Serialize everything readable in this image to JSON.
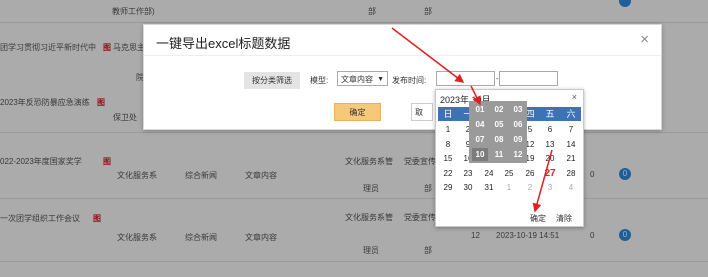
{
  "background_table": {
    "rows": [
      {
        "title": "",
        "dept_frag": "教师工作部)",
        "col3": "部",
        "col4": "部"
      },
      {
        "title": "团学习贯彻习近平新时代中",
        "doc_tag": "图",
        "person": "马克思主"
      },
      {
        "person2": "院"
      },
      {
        "title": "2023年反恐防暴应急演练",
        "doc_tag": "图",
        "dept": "保卫处"
      },
      {
        "title": "022-2023年度国家奖学",
        "doc_tag": "图",
        "dept": "文化服务系",
        "category": "综合新闻",
        "type": "文章内容",
        "dept_mgmt": "文化服务系管",
        "publisher": "党委宣传",
        "org_frag": "理员",
        "org_frag2": "部",
        "views": "0",
        "badge": "0"
      },
      {
        "title": "一次团学组织工作会议",
        "doc_tag": "图",
        "dept": "文化服务系",
        "category": "综合新闻",
        "type": "文章内容",
        "dept_mgmt": "文化服务系管",
        "publisher": "党委宣传",
        "org_frag": "理员",
        "org_frag2": "部",
        "count": "12",
        "datetime": "2023-10-19 14:51",
        "views": "0",
        "badge": "0"
      }
    ]
  },
  "modal": {
    "title": "一键导出excel标题数据",
    "close": "×",
    "filter_tag": "按分类筛选",
    "model_label": "模型:",
    "model_value": "文章内容",
    "publish_label": "发布时间:",
    "range_sep": "-",
    "ok": "确定",
    "cancel": "取"
  },
  "calendar": {
    "header": "2023年 10月",
    "close": "×",
    "weekdays": [
      "日",
      "一",
      "二",
      "三",
      "四",
      "五",
      "六"
    ],
    "months": [
      "01",
      "02",
      "03",
      "04",
      "05",
      "06",
      "07",
      "08",
      "09",
      "10",
      "11",
      "12"
    ],
    "selected_month": "10",
    "weeks": [
      [
        "1",
        "2",
        "3",
        "4",
        "5",
        "6",
        "7"
      ],
      [
        "8",
        "9",
        "10",
        "11",
        "12",
        "13",
        "14"
      ],
      [
        "15",
        "16",
        "17",
        "18",
        "19",
        "20",
        "21"
      ],
      [
        "22",
        "23",
        "24",
        "25",
        "26",
        "27",
        "28"
      ],
      [
        "29",
        "30",
        "31",
        "1",
        "2",
        "3",
        "4"
      ]
    ],
    "today": "27",
    "ok": "确定",
    "clear": "清除",
    "accent": "#3d73b5"
  }
}
